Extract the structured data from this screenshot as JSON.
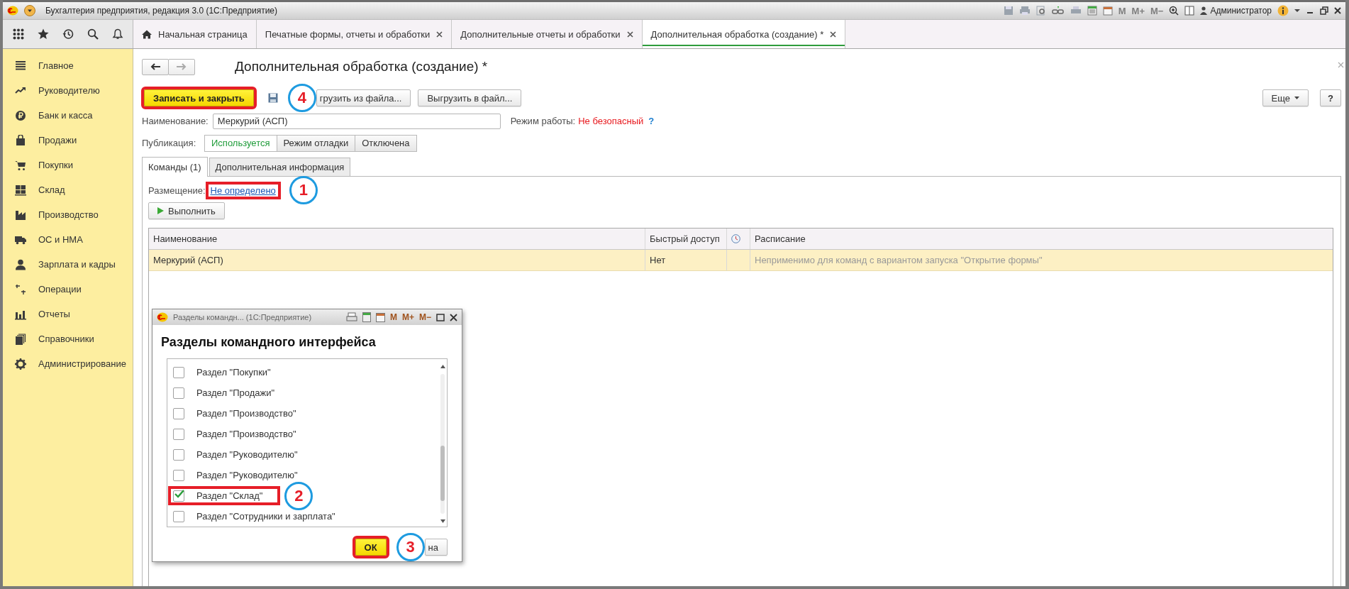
{
  "window": {
    "title": "Бухгалтерия предприятия, редакция 3.0  (1С:Предприятие)",
    "memory_buttons": [
      "M",
      "M+",
      "M−"
    ],
    "user": "Администратор"
  },
  "tabs": [
    {
      "label": "Начальная страница",
      "kind": "home",
      "closable": false,
      "selected": false
    },
    {
      "label": "Печатные формы, отчеты и обработки",
      "kind": "page",
      "closable": true,
      "selected": false
    },
    {
      "label": "Дополнительные отчеты и обработки",
      "kind": "page",
      "closable": true,
      "selected": false
    },
    {
      "label": "Дополнительная обработка (создание) *",
      "kind": "page",
      "closable": true,
      "selected": true
    }
  ],
  "sidebar": {
    "items": [
      {
        "label": "Главное"
      },
      {
        "label": "Руководителю"
      },
      {
        "label": "Банк и касса"
      },
      {
        "label": "Продажи"
      },
      {
        "label": "Покупки"
      },
      {
        "label": "Склад"
      },
      {
        "label": "Производство"
      },
      {
        "label": "ОС и НМА"
      },
      {
        "label": "Зарплата и кадры"
      },
      {
        "label": "Операции"
      },
      {
        "label": "Отчеты"
      },
      {
        "label": "Справочники"
      },
      {
        "label": "Администрирование"
      }
    ]
  },
  "form": {
    "title": "Дополнительная обработка (создание) *",
    "command_bar": [
      {
        "label": "Записать и закрыть",
        "kind": "default",
        "highlighted": true
      },
      {
        "kind": "save"
      },
      {
        "label": "грузить из файла...",
        "kind": "normal",
        "highlighted": false,
        "callout": "4"
      },
      {
        "label": "Выгрузить в файл...",
        "kind": "normal",
        "highlighted": false
      }
    ],
    "more_button": "Еще",
    "help_button": "?",
    "name_label": "Наименование:",
    "name_value": "Меркурий (АСП)",
    "mode_label": "Режим работы:",
    "mode_value": "Не безопасный",
    "mode_help": "?",
    "publication": {
      "label": "Публикация:",
      "options": [
        {
          "label": "Используется",
          "selected": true
        },
        {
          "label": "Режим отладки",
          "selected": false
        },
        {
          "label": "Отключена",
          "selected": false
        }
      ]
    },
    "tabs": [
      {
        "label": "Команды (1)",
        "selected": true
      },
      {
        "label": "Дополнительная информация",
        "selected": false
      }
    ],
    "placement": {
      "label": "Размещение:",
      "link": "Не определено",
      "highlighted": true,
      "callout": "1"
    },
    "run_button": "Выполнить",
    "table": {
      "columns": [
        "Наименование",
        "Быстрый доступ",
        "",
        "Расписание"
      ],
      "rows": [
        {
          "cells": [
            "Меркурий (АСП)",
            "Нет",
            "",
            "Неприменимо для команд с вариантом запуска \"Открытие формы\""
          ],
          "selected": true
        }
      ]
    }
  },
  "dialog": {
    "title": "Разделы командн... (1С:Предприятие)",
    "memory_buttons": [
      "M",
      "M+",
      "M−"
    ],
    "heading": "Разделы командного интерфейса",
    "items": [
      {
        "label": "Раздел \"Покупки\"",
        "checked": false,
        "highlighted": false
      },
      {
        "label": "Раздел \"Продажи\"",
        "checked": false,
        "highlighted": false
      },
      {
        "label": "Раздел \"Производство\"",
        "checked": false,
        "highlighted": false
      },
      {
        "label": "Раздел \"Производство\"",
        "checked": false,
        "highlighted": false
      },
      {
        "label": "Раздел \"Руководителю\"",
        "checked": false,
        "highlighted": false
      },
      {
        "label": "Раздел \"Руководителю\"",
        "checked": false,
        "highlighted": false
      },
      {
        "label": "Раздел \"Склад\"",
        "checked": true,
        "highlighted": true,
        "callout": "2"
      },
      {
        "label": "Раздел \"Сотрудники и зарплата\"",
        "checked": false,
        "highlighted": false
      }
    ],
    "buttons": [
      {
        "label": "ОК",
        "kind": "default",
        "highlighted": true
      },
      {
        "label": "на",
        "kind": "normal",
        "highlighted": false,
        "callout": "3"
      }
    ]
  }
}
